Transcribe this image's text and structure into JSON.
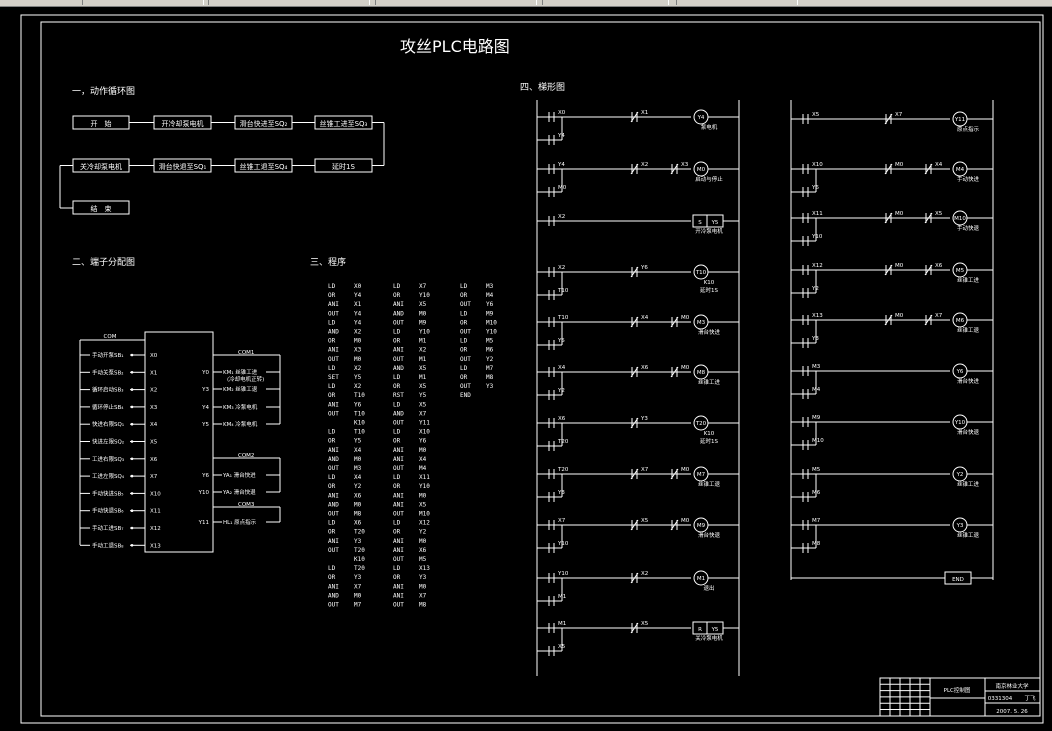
{
  "title": "攻丝PLC电路图",
  "sections": {
    "cycle": "一，动作循环图",
    "terminal": "二、端子分配图",
    "program": "三、程序",
    "ladder": "四、梯形图"
  },
  "cycle": {
    "row1": [
      "开　始",
      "开冷却泵电机",
      "滑台快进至SQ₂",
      "丝锥工进至SQ₃"
    ],
    "row2": [
      "关冷却泵电机",
      "滑台快退至SQ₁",
      "丝锥工退至SQ₄",
      "延时1S"
    ],
    "end": "结　束"
  },
  "terminal": {
    "com_in": "COM",
    "inputs": [
      {
        "label": "手动开泵SB₁",
        "addr": "X0"
      },
      {
        "label": "手动关泵SB₂",
        "addr": "X1"
      },
      {
        "label": "循环启动SB₃",
        "addr": "X2"
      },
      {
        "label": "循环停止SB₄",
        "addr": "X3"
      },
      {
        "label": "快进右限SQ₁",
        "addr": "X4"
      },
      {
        "label": "快进左限SQ₂",
        "addr": "X5"
      },
      {
        "label": "工进右限SQ₃",
        "addr": "X6"
      },
      {
        "label": "工进左限SQ₄",
        "addr": "X7"
      },
      {
        "label": "手动快进SB₅",
        "addr": "X10"
      },
      {
        "label": "手动快退SB₆",
        "addr": "X11"
      },
      {
        "label": "手动工进SB₇",
        "addr": "X12"
      },
      {
        "label": "手动工退SB₈",
        "addr": "X13"
      }
    ],
    "outputs": [
      {
        "addr": "Y0",
        "coil": "KM₁",
        "label": "丝锥工进",
        "note": "(冷却电机正转)"
      },
      {
        "addr": "Y3",
        "coil": "KM₂",
        "label": "丝锥工退",
        "note": ""
      },
      {
        "addr": "Y4",
        "coil": "KM₃",
        "label": "冷泵电机",
        "note": ""
      },
      {
        "addr": "Y5",
        "coil": "KM₄",
        "label": "冷泵电机",
        "note": ""
      },
      {
        "addr": "Y6",
        "coil": "YA₁",
        "label": "滑台快进",
        "note": ""
      },
      {
        "addr": "Y10",
        "coil": "YA₂",
        "label": "滑台快退",
        "note": ""
      },
      {
        "addr": "Y11",
        "coil": "HL₁",
        "label": "原点指示",
        "note": ""
      }
    ],
    "coms": [
      "COM1",
      "COM2",
      "COM3"
    ]
  },
  "program": {
    "col1": [
      [
        "LD",
        "X0"
      ],
      [
        "OR",
        "Y4"
      ],
      [
        "ANI",
        "X1"
      ],
      [
        "OUT",
        "Y4"
      ],
      [
        "LD",
        "Y4"
      ],
      [
        "AND",
        "X2"
      ],
      [
        "OR",
        "M0"
      ],
      [
        "ANI",
        "X3"
      ],
      [
        "OUT",
        "M0"
      ],
      [
        "LD",
        "X2"
      ],
      [
        "SET",
        "Y5"
      ],
      [
        "LD",
        "X2"
      ],
      [
        "OR",
        "T10"
      ],
      [
        "ANI",
        "Y6"
      ],
      [
        "OUT",
        "T10"
      ],
      [
        "",
        "K10"
      ],
      [
        "LD",
        "T10"
      ],
      [
        "OR",
        "Y5"
      ],
      [
        "ANI",
        "X4"
      ],
      [
        "AND",
        "M0"
      ],
      [
        "OUT",
        "M3"
      ],
      [
        "LD",
        "X4"
      ],
      [
        "OR",
        "Y2"
      ],
      [
        "ANI",
        "X6"
      ],
      [
        "AND",
        "M0"
      ],
      [
        "OUT",
        "M8"
      ],
      [
        "LD",
        "X6"
      ],
      [
        "OR",
        "T20"
      ],
      [
        "ANI",
        "Y3"
      ],
      [
        "OUT",
        "T20"
      ],
      [
        "",
        "K10"
      ],
      [
        "LD",
        "T20"
      ],
      [
        "OR",
        "Y3"
      ],
      [
        "ANI",
        "X7"
      ],
      [
        "AND",
        "M0"
      ],
      [
        "OUT",
        "M7"
      ]
    ],
    "col2": [
      [
        "LD",
        "X7"
      ],
      [
        "OR",
        "Y10"
      ],
      [
        "ANI",
        "X5"
      ],
      [
        "AND",
        "M0"
      ],
      [
        "OUT",
        "M9"
      ],
      [
        "LD",
        "Y10"
      ],
      [
        "OR",
        "M1"
      ],
      [
        "ANI",
        "X2"
      ],
      [
        "OUT",
        "M1"
      ],
      [
        "AND",
        "X5"
      ],
      [
        "LD",
        "M1"
      ],
      [
        "OR",
        "X5"
      ],
      [
        "RST",
        "Y5"
      ],
      [
        "LD",
        "X5"
      ],
      [
        "AND",
        "X7"
      ],
      [
        "OUT",
        "Y11"
      ],
      [
        "LD",
        "X10"
      ],
      [
        "OR",
        "Y6"
      ],
      [
        "ANI",
        "M0"
      ],
      [
        "ANI",
        "X4"
      ],
      [
        "OUT",
        "M4"
      ],
      [
        "LD",
        "X11"
      ],
      [
        "OR",
        "Y10"
      ],
      [
        "ANI",
        "M0"
      ],
      [
        "ANI",
        "X5"
      ],
      [
        "OUT",
        "M10"
      ],
      [
        "LD",
        "X12"
      ],
      [
        "OR",
        "Y2"
      ],
      [
        "ANI",
        "M0"
      ],
      [
        "ANI",
        "X6"
      ],
      [
        "OUT",
        "M5"
      ],
      [
        "LD",
        "X13"
      ],
      [
        "OR",
        "Y3"
      ],
      [
        "ANI",
        "M0"
      ],
      [
        "ANI",
        "X7"
      ],
      [
        "OUT",
        "M8"
      ]
    ],
    "col3": [
      [
        "LD",
        "M3"
      ],
      [
        "OR",
        "M4"
      ],
      [
        "OUT",
        "Y6"
      ],
      [
        "LD",
        "M9"
      ],
      [
        "OR",
        "M10"
      ],
      [
        "OUT",
        "Y10"
      ],
      [
        "LD",
        "M5"
      ],
      [
        "OR",
        "M6"
      ],
      [
        "OUT",
        "Y2"
      ],
      [
        "LD",
        "M7"
      ],
      [
        "OR",
        "M8"
      ],
      [
        "OUT",
        "Y3"
      ],
      [
        "END",
        ""
      ]
    ]
  },
  "ladder_left": [
    {
      "a": "X0",
      "b": "X1",
      "p": "Y4",
      "coil": "Y4",
      "label": "泵电机"
    },
    {
      "a": "Y4",
      "b": "X2",
      "c": "X3",
      "p": "M0",
      "coil": "M0",
      "label": "启动与停止"
    },
    {
      "a": "X2",
      "coil": "S Y5",
      "label": "开冷泵电机"
    },
    {
      "a": "X2",
      "b": "Y6",
      "p": "T10",
      "coil": "T10",
      "label": "K10 延时1S"
    },
    {
      "a": "T10",
      "b": "X4",
      "c": "M0",
      "p": "Y5",
      "coil": "M3",
      "label": "滑台快进"
    },
    {
      "a": "X4",
      "b": "X6",
      "c": "M0",
      "p": "Y2",
      "coil": "M8",
      "label": "丝锥工进"
    },
    {
      "a": "X6",
      "b": "Y3",
      "p": "T20",
      "coil": "T20",
      "label": "K10 延时1S"
    },
    {
      "a": "T20",
      "b": "X7",
      "c": "M0",
      "p": "Y3",
      "coil": "M7",
      "label": "丝锥工退"
    },
    {
      "a": "X7",
      "b": "X5",
      "c": "M0",
      "p": "Y10",
      "coil": "M9",
      "label": "滑台快退"
    },
    {
      "a": "Y10",
      "b": "X2",
      "p": "M1",
      "coil": "M1",
      "label": "退出"
    },
    {
      "a": "M1",
      "b": "X5",
      "p": "X5",
      "coil": "R Y5",
      "label": "关冷泵电机"
    }
  ],
  "ladder_right": [
    {
      "a": "X5",
      "b": "X7",
      "coil": "Y11",
      "label": "原点指示"
    },
    {
      "a": "X10",
      "b": "M0",
      "c": "X4",
      "p": "Y6",
      "coil": "M4",
      "label": "手动快进"
    },
    {
      "a": "X11",
      "b": "M0",
      "c": "X5",
      "p": "Y10",
      "coil": "M10",
      "label": "手动快退"
    },
    {
      "a": "X12",
      "b": "M0",
      "c": "X6",
      "p": "Y2",
      "coil": "M5",
      "label": "丝锥工进"
    },
    {
      "a": "X13",
      "b": "M0",
      "c": "X7",
      "p": "Y3",
      "coil": "M6",
      "label": "丝锥工退"
    },
    {
      "a": "M3",
      "p": "M4",
      "coil": "Y6",
      "label": "滑台快进"
    },
    {
      "a": "M9",
      "p": "M10",
      "coil": "Y10",
      "label": "滑台快退"
    },
    {
      "a": "M5",
      "p": "M6",
      "coil": "Y2",
      "label": "丝锥工进"
    },
    {
      "a": "M7",
      "p": "M8",
      "coil": "Y3",
      "label": "丝锥工退"
    },
    {
      "end": "END"
    }
  ],
  "titleblock": {
    "drawing": "PLC控制图",
    "school": "南京林业大学",
    "number": "0331304",
    "page": "丁飞",
    "date": "2007. 5. 26"
  }
}
